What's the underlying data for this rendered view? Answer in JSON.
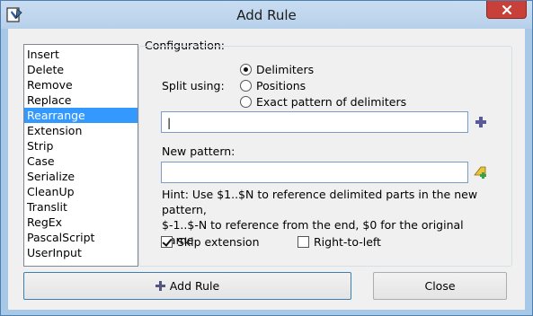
{
  "window": {
    "title": "Add Rule",
    "app_icon": "renamer-app-icon",
    "close_icon": "close-icon"
  },
  "rules": {
    "items": [
      "Insert",
      "Delete",
      "Remove",
      "Replace",
      "Rearrange",
      "Extension",
      "Strip",
      "Case",
      "Serialize",
      "CleanUp",
      "Translit",
      "RegEx",
      "PascalScript",
      "UserInput"
    ],
    "selected": "Rearrange"
  },
  "config": {
    "label": "Configuration:",
    "split_label": "Split using:",
    "options": {
      "delimiters": "Delimiters",
      "positions": "Positions",
      "exact": "Exact pattern of delimiters"
    },
    "selected_option": "Delimiters",
    "delimiter_value": "|",
    "new_pattern_label": "New pattern:",
    "new_pattern_value": "",
    "hint_line1": "Hint: Use $1..$N to reference delimited parts in the new pattern,",
    "hint_line2": "$-1..$-N to reference from the end, $0 for the original name.",
    "skip_extension_label": "Skip extension",
    "skip_extension_checked": true,
    "right_to_left_label": "Right-to-left",
    "right_to_left_checked": false
  },
  "buttons": {
    "add_rule": "Add Rule",
    "close": "Close"
  },
  "colors": {
    "selection": "#3399ff",
    "close_button": "#c7403a",
    "title_bar": "#b7d0ea"
  }
}
